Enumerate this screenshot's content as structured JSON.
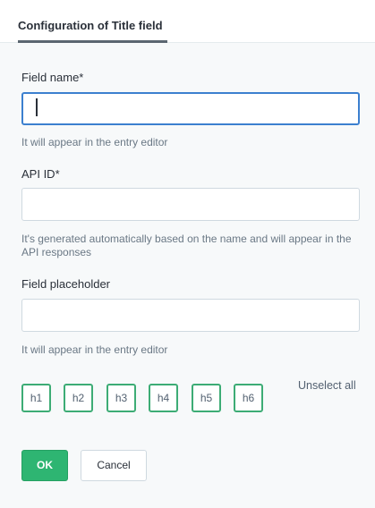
{
  "header": {
    "tab_label": "Configuration of Title field"
  },
  "form": {
    "field_name": {
      "label": "Field name*",
      "value": "",
      "hint": "It will appear in the entry editor"
    },
    "api_id": {
      "label": "API ID*",
      "value": "",
      "hint": "It's generated automatically based on the name and will appear in the API responses"
    },
    "field_placeholder": {
      "label": "Field placeholder",
      "value": "",
      "hint": "It will appear in the entry editor"
    },
    "headings": {
      "unselect_label": "Unselect all",
      "items": [
        "h1",
        "h2",
        "h3",
        "h4",
        "h5",
        "h6"
      ]
    }
  },
  "actions": {
    "ok_label": "OK",
    "cancel_label": "Cancel"
  },
  "colors": {
    "accent_green": "#2eb572",
    "focus_blue": "#3c80cf"
  }
}
